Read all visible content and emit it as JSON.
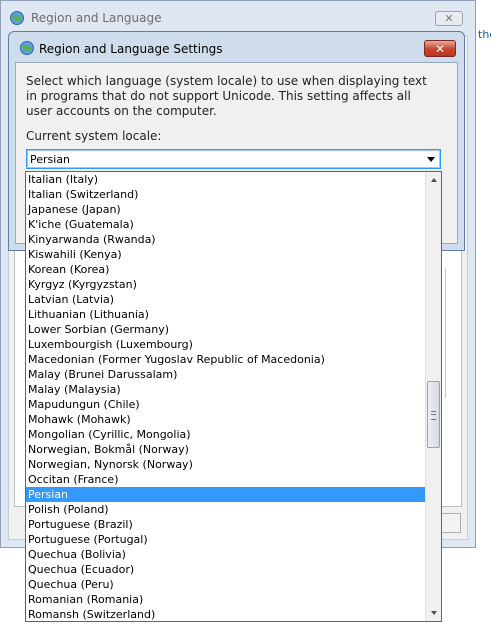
{
  "background_window": {
    "title": "Region and Language",
    "close_label": "✕",
    "side_link": "the"
  },
  "dialog": {
    "title": "Region and Language Settings",
    "close_label": "✕",
    "description": "Select which language (system locale) to use when displaying text in programs that do not support Unicode. This setting affects all user accounts on the computer.",
    "locale_label": "Current system locale:",
    "selected_locale": "Persian",
    "icons": {
      "dialog": "globe-icon",
      "background_window": "globe-icon",
      "dropdown": "chevron-down-icon"
    }
  },
  "locale_list": {
    "items": [
      "Italian (Italy)",
      "Italian (Switzerland)",
      "Japanese (Japan)",
      "K'iche (Guatemala)",
      "Kinyarwanda (Rwanda)",
      "Kiswahili (Kenya)",
      "Korean (Korea)",
      "Kyrgyz (Kyrgyzstan)",
      "Latvian (Latvia)",
      "Lithuanian (Lithuania)",
      "Lower Sorbian (Germany)",
      "Luxembourgish (Luxembourg)",
      "Macedonian (Former Yugoslav Republic of Macedonia)",
      "Malay (Brunei Darussalam)",
      "Malay (Malaysia)",
      "Mapudungun (Chile)",
      "Mohawk (Mohawk)",
      "Mongolian (Cyrillic, Mongolia)",
      "Norwegian, Bokmål (Norway)",
      "Norwegian, Nynorsk (Norway)",
      "Occitan (France)",
      "Persian",
      "Polish (Poland)",
      "Portuguese (Brazil)",
      "Portuguese (Portugal)",
      "Quechua (Bolivia)",
      "Quechua (Ecuador)",
      "Quechua (Peru)",
      "Romanian (Romania)",
      "Romansh (Switzerland)"
    ],
    "selected_index": 21,
    "scroll_position": 0.55,
    "visible_fraction": 0.1
  },
  "colors": {
    "selection": "#3399ff",
    "close_button": "#c7452f",
    "focus_border": "#3399ff"
  }
}
